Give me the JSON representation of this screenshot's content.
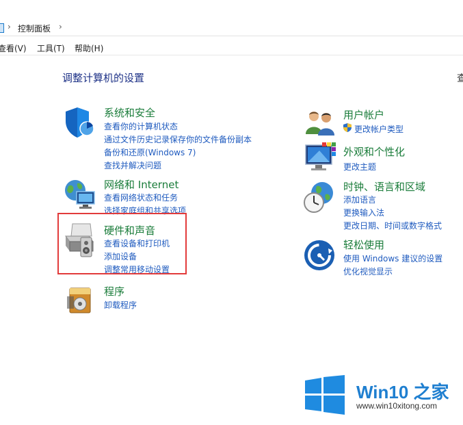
{
  "address_bar": {
    "crumbs": [
      "控制面板"
    ]
  },
  "menu": {
    "view": "查看(V)",
    "tools": "工具(T)",
    "help": "帮助(H)"
  },
  "page_title": "调整计算机的设置",
  "view_by_partial": "查",
  "categories": {
    "system_security": {
      "title": "系统和安全",
      "links": [
        "查看你的计算机状态",
        "通过文件历史记录保存你的文件备份副本",
        "备份和还原(Windows 7)",
        "查找并解决问题"
      ]
    },
    "network": {
      "title": "网络和 Internet",
      "links": [
        "查看网络状态和任务",
        "选择家庭组和共享选项"
      ]
    },
    "hardware_sound": {
      "title": "硬件和声音",
      "links": [
        "查看设备和打印机",
        "添加设备",
        "调整常用移动设置"
      ]
    },
    "programs": {
      "title": "程序",
      "links": [
        "卸载程序"
      ]
    },
    "user_accounts": {
      "title": "用户帐户",
      "links": [
        "更改帐户类型"
      ]
    },
    "appearance": {
      "title": "外观和个性化",
      "links": [
        "更改主题"
      ]
    },
    "clock_language": {
      "title": "时钟、语言和区域",
      "links": [
        "添加语言",
        "更换输入法",
        "更改日期、时间或数字格式"
      ]
    },
    "ease_access": {
      "title": "轻松使用",
      "links": [
        "使用 Windows 建议的设置",
        "优化视觉显示"
      ]
    }
  },
  "watermark": {
    "title": "Win10 之家",
    "url": "www.win10xitong.com"
  },
  "colors": {
    "link": "#1f5bbf",
    "category_title": "#1a7c3a",
    "highlight": "#e23a3a",
    "brand": "#1f7fd0"
  }
}
